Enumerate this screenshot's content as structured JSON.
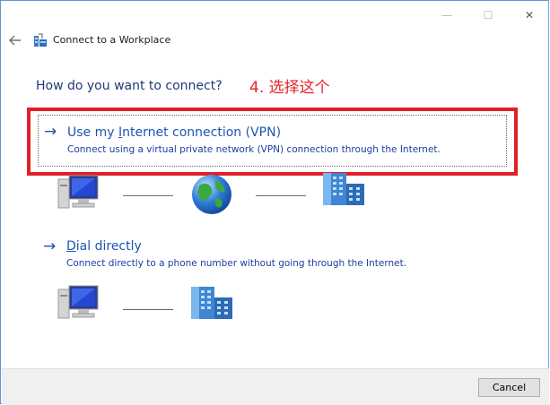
{
  "window": {
    "title": "Connect to a Workplace",
    "minimize_glyph": "—",
    "maximize_glyph": "☐",
    "close_glyph": "✕"
  },
  "question": "How do you want to connect?",
  "annotation": "4. 选择这个",
  "options": [
    {
      "title_pre": "Use my ",
      "title_mnemonic": "I",
      "title_post": "nternet connection (VPN)",
      "description": "Connect using a virtual private network (VPN) connection through the Internet."
    },
    {
      "title_pre": "",
      "title_mnemonic": "D",
      "title_post": "ial directly",
      "description": "Connect directly to a phone number without going through the Internet."
    }
  ],
  "footer": {
    "cancel_label": "Cancel"
  },
  "icons": {
    "back": "left-arrow-icon",
    "app": "network-workplace-icon",
    "computer": "computer-icon",
    "globe": "globe-icon",
    "building": "building-icon"
  }
}
